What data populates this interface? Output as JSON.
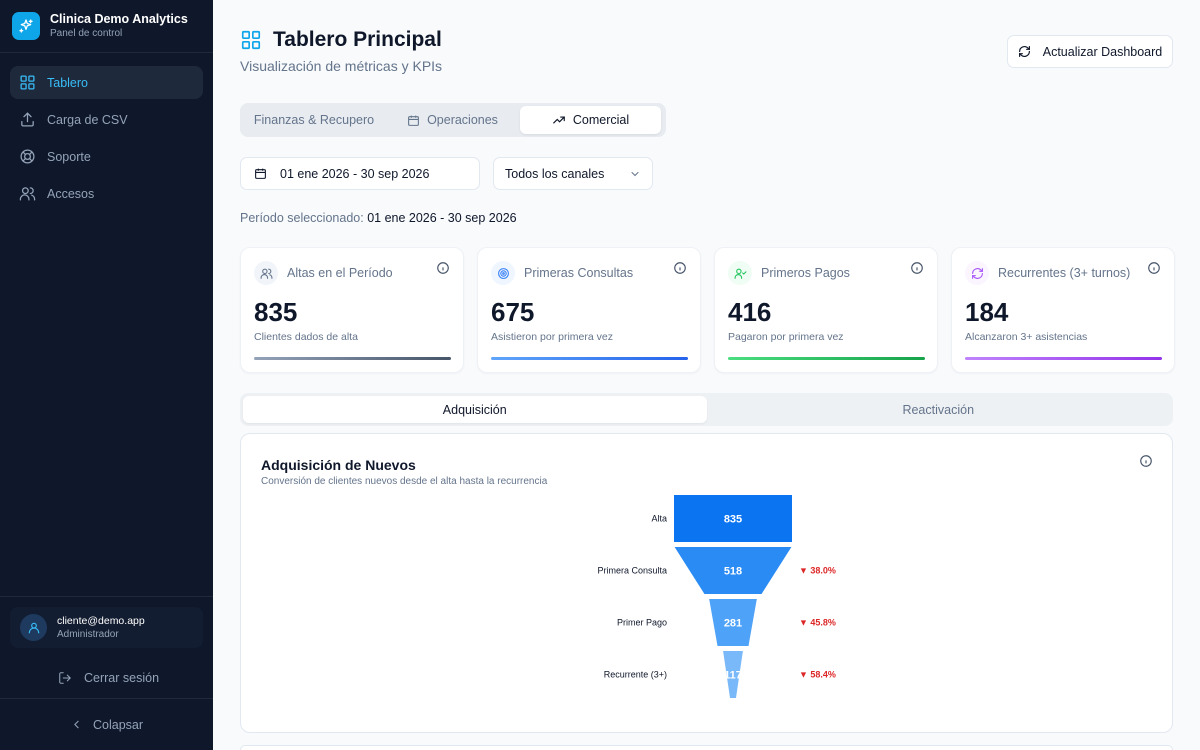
{
  "brand": {
    "title": "Clinica Demo Analytics",
    "subtitle": "Panel de control",
    "icon": "sparkle-icon",
    "accent": "#0ea5e9"
  },
  "sidebar": {
    "items": [
      {
        "label": "Tablero",
        "icon": "dashboard-icon",
        "active": true
      },
      {
        "label": "Carga de CSV",
        "icon": "upload-icon",
        "active": false
      },
      {
        "label": "Soporte",
        "icon": "lifebuoy-icon",
        "active": false
      },
      {
        "label": "Accesos",
        "icon": "users-icon",
        "active": false
      }
    ],
    "user": {
      "email": "cliente@demo.app",
      "role": "Administrador"
    },
    "logout_label": "Cerrar sesión",
    "collapse_label": "Colapsar"
  },
  "header": {
    "title": "Tablero Principal",
    "subtitle": "Visualización de métricas y KPIs",
    "refresh_label": "Actualizar Dashboard"
  },
  "section_tabs": [
    {
      "label": "Finanzas & Recupero",
      "active": false
    },
    {
      "label": "Operaciones",
      "active": false
    },
    {
      "label": "Comercial",
      "active": true
    }
  ],
  "filters": {
    "date_range": "01 ene 2026 - 30 sep 2026",
    "channel": "Todos los canales",
    "period_prefix": "Período seleccionado:",
    "period_value": "01 ene 2026 - 30 sep 2026"
  },
  "kpis": [
    {
      "label": "Altas en el Período",
      "value": "835",
      "desc": "Clientes dados de alta",
      "icon": "users-icon",
      "color": "#64748b"
    },
    {
      "label": "Primeras Consultas",
      "value": "675",
      "desc": "Asistieron por primera vez",
      "icon": "target-icon",
      "color": "#3b82f6"
    },
    {
      "label": "Primeros Pagos",
      "value": "416",
      "desc": "Pagaron por primera vez",
      "icon": "user-check-icon",
      "color": "#22c55e"
    },
    {
      "label": "Recurrentes (3+ turnos)",
      "value": "184",
      "desc": "Alcanzaron 3+ asistencias",
      "icon": "refresh-icon",
      "color": "#a855f7"
    }
  ],
  "sub_tabs": [
    {
      "label": "Adquisición",
      "active": true
    },
    {
      "label": "Reactivación",
      "active": false
    }
  ],
  "funnel": {
    "title": "Adquisición de Nuevos",
    "subtitle": "Conversión de clientes nuevos desde el alta hasta la recurrencia"
  },
  "chart_data": {
    "type": "funnel",
    "categories": [
      "Alta",
      "Primera Consulta",
      "Primer Pago",
      "Recurrente (3+)"
    ],
    "values": [
      835,
      518,
      281,
      117
    ],
    "drops": [
      "",
      "▼ 38.0%",
      "▼ 45.8%",
      "▼ 58.4%"
    ],
    "colors": [
      "#0b74f0",
      "#2a8bf5",
      "#4ea2f7",
      "#79b9f9"
    ]
  }
}
